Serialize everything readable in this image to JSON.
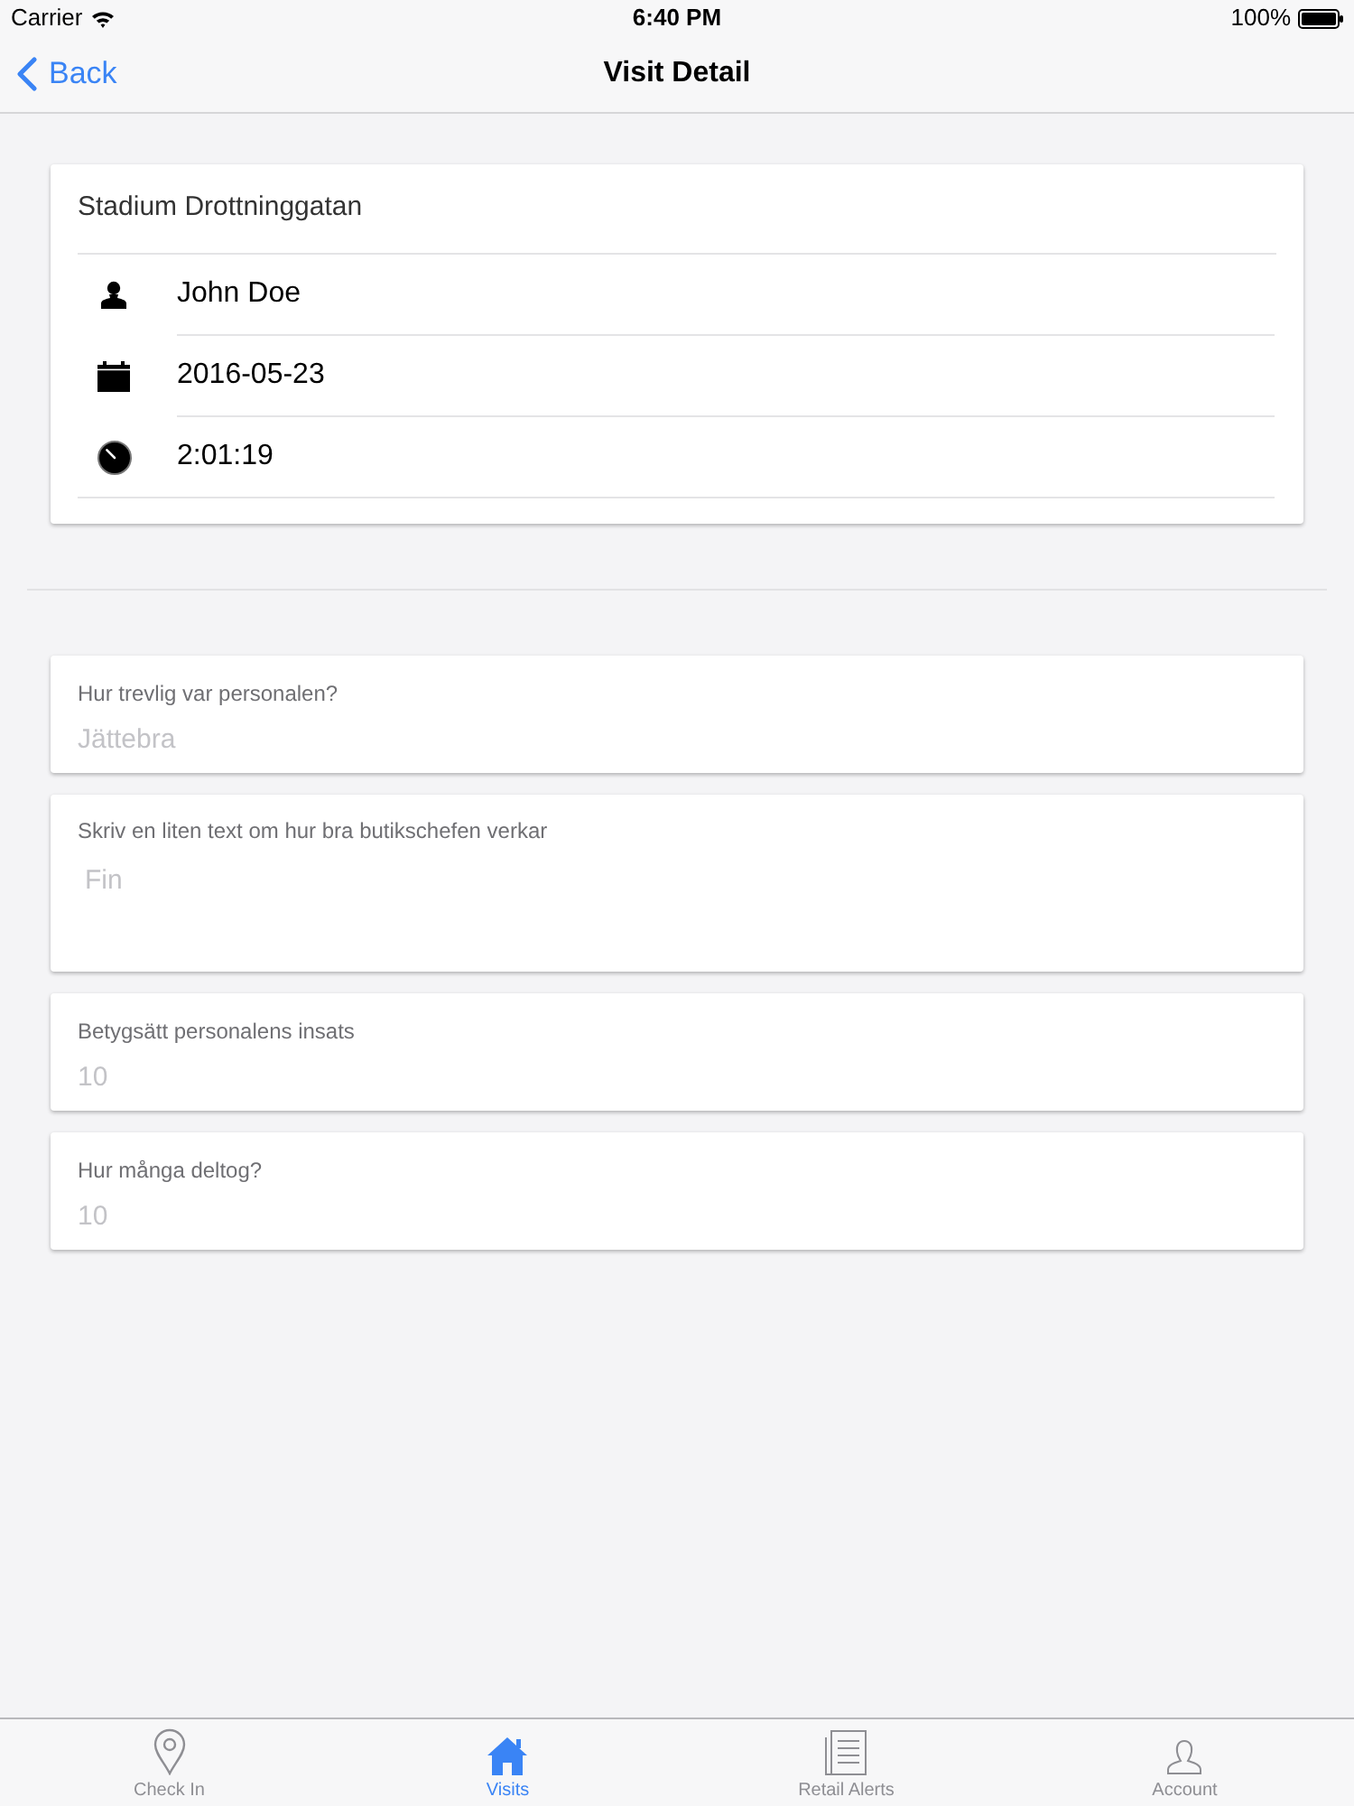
{
  "status_bar": {
    "carrier": "Carrier",
    "time": "6:40 PM",
    "battery": "100%"
  },
  "nav_bar": {
    "back": "Back",
    "title": "Visit Detail"
  },
  "visit": {
    "store": "Stadium Drottninggatan",
    "rows": [
      {
        "kind": "person",
        "text": "John Doe"
      },
      {
        "kind": "date",
        "text": "2016-05-23"
      },
      {
        "kind": "duration",
        "text": "2:01:19"
      }
    ]
  },
  "questions": [
    {
      "kind": "line",
      "label": "Hur trevlig var personalen?",
      "value": "Jättebra"
    },
    {
      "kind": "multiline",
      "label": "Skriv en liten text om hur bra butikschefen verkar",
      "value": "Fin"
    },
    {
      "kind": "line",
      "label": "Betygsätt personalens insats",
      "value": "10"
    },
    {
      "kind": "line",
      "label": "Hur många deltog?",
      "value": "10"
    }
  ],
  "tab_bar": [
    {
      "kind": "check_in",
      "label": "Check In",
      "selected": false
    },
    {
      "kind": "visits",
      "label": "Visits",
      "selected": true
    },
    {
      "kind": "alerts",
      "label": "Retail Alerts",
      "selected": false
    },
    {
      "kind": "account",
      "label": "Account",
      "selected": false
    }
  ]
}
